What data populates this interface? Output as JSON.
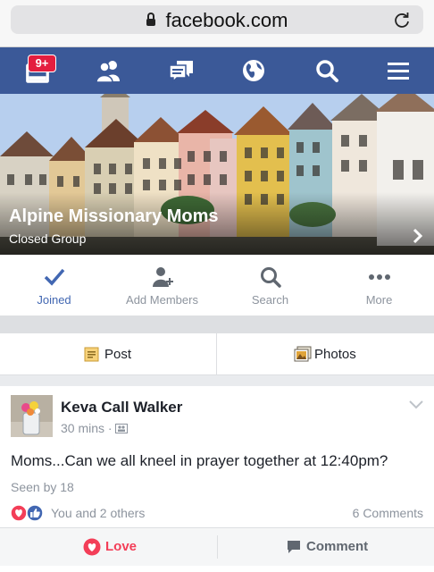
{
  "browser": {
    "url": "facebook.com"
  },
  "navbar": {
    "notification_badge": "9+",
    "icons": [
      "notifications-icon",
      "friends-icon",
      "messages-icon",
      "globe-icon",
      "search-icon",
      "menu-icon"
    ]
  },
  "group": {
    "name": "Alpine Missionary Moms",
    "privacy": "Closed Group"
  },
  "actions": [
    {
      "label": "Joined",
      "icon": "checkmark-icon",
      "active": true
    },
    {
      "label": "Add Members",
      "icon": "add-member-icon"
    },
    {
      "label": "Search",
      "icon": "search-icon"
    },
    {
      "label": "More",
      "icon": "more-dots-icon"
    }
  ],
  "composer": {
    "post_label": "Post",
    "photos_label": "Photos"
  },
  "post": {
    "author": "Keva Call Walker",
    "time": "30 mins",
    "text": "Moms...Can we all kneel in prayer together at 12:40pm?",
    "seen": "Seen by 18",
    "reactions_text": "You and 2 others",
    "comments": "6 Comments",
    "love_label": "Love",
    "comment_label": "Comment"
  },
  "colors": {
    "brand": "#3b5998",
    "accent": "#4267b2",
    "love": "#f33e58"
  }
}
